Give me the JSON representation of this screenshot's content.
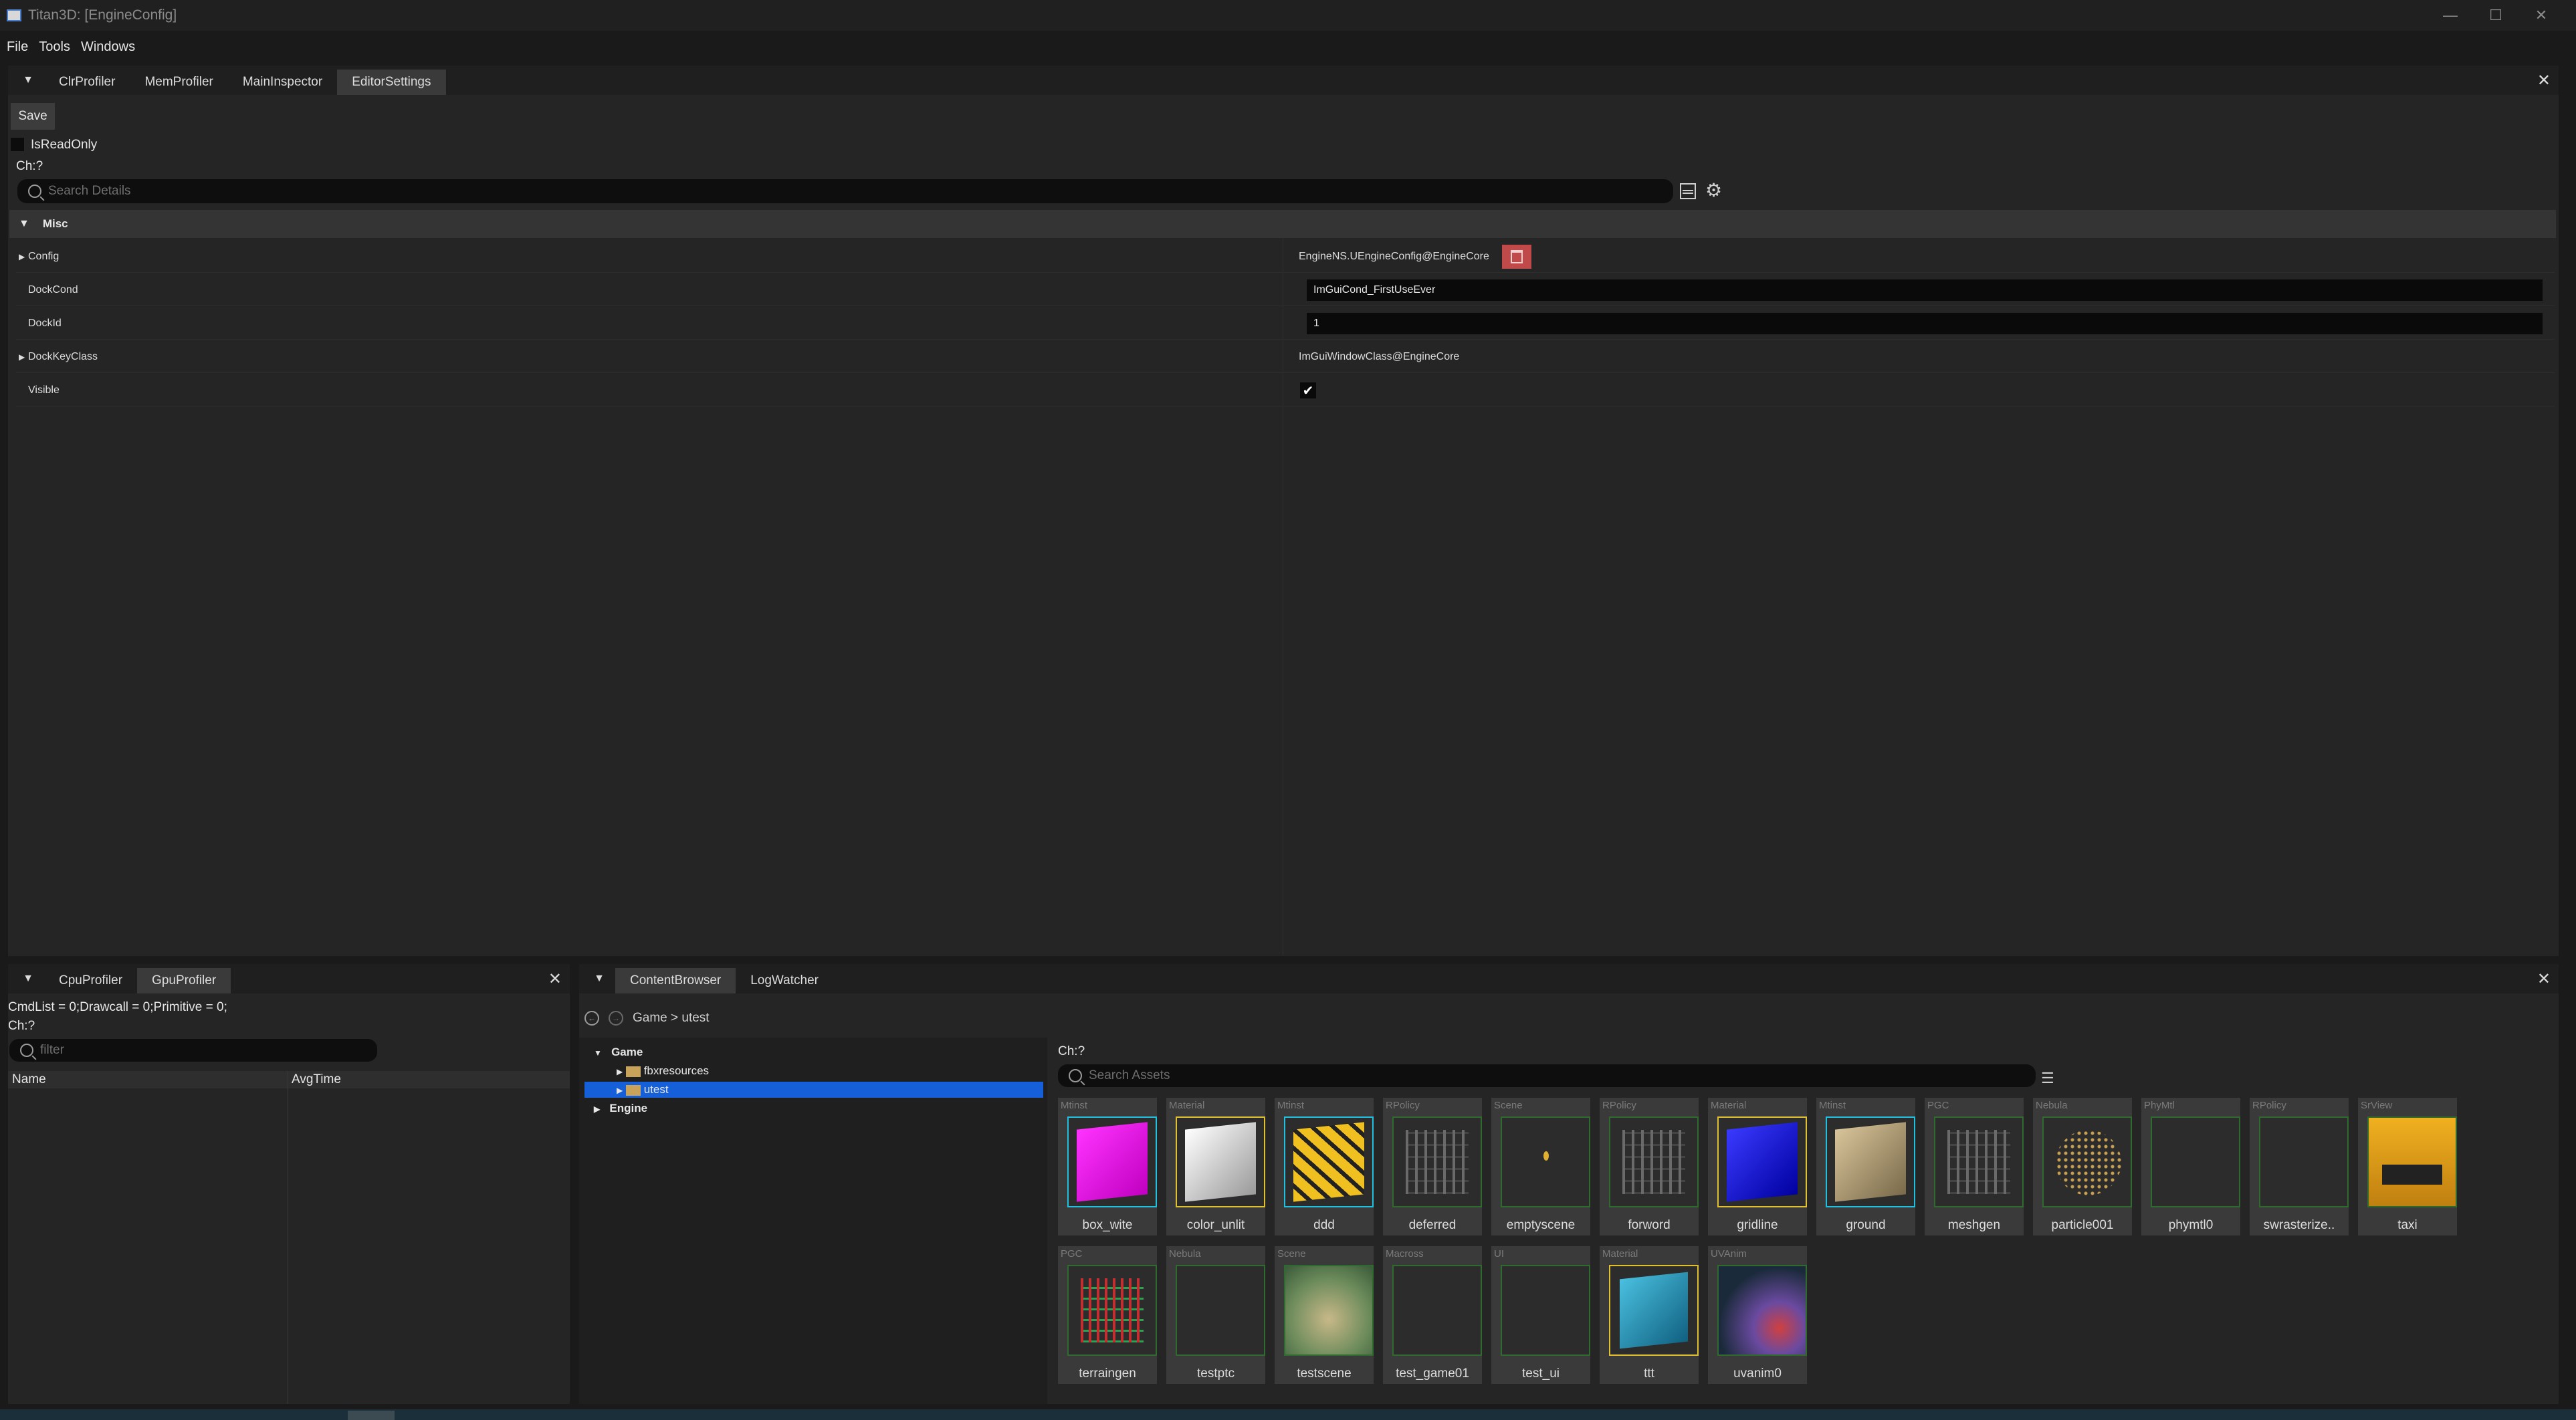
{
  "window": {
    "title": "Titan3D: [EngineConfig]"
  },
  "menu": [
    "File",
    "Tools",
    "Windows"
  ],
  "top_panel": {
    "tabs": [
      "ClrProfiler",
      "MemProfiler",
      "MainInspector",
      "EditorSettings"
    ],
    "active_tab": 3,
    "save_label": "Save",
    "readonly_label": "IsReadOnly",
    "ch_label": "Ch:?",
    "search_placeholder": "Search Details",
    "category": "Misc",
    "properties": [
      {
        "name": "Config",
        "value": "EngineNS.UEngineConfig@EngineCore",
        "expandable": true
      },
      {
        "name": "DockCond",
        "value": "ImGuiCond_FirstUseEver",
        "input": true
      },
      {
        "name": "DockId",
        "value": "1",
        "input": true
      },
      {
        "name": "DockKeyClass",
        "value": "ImGuiWindowClass@EngineCore",
        "expandable": true
      },
      {
        "name": "Visible",
        "checked": true
      }
    ]
  },
  "gpu_panel": {
    "tabs": [
      "CpuProfiler",
      "GpuProfiler"
    ],
    "active_tab": 1,
    "stats": "CmdList = 0;Drawcall = 0;Primitive = 0;",
    "ch_label": "Ch:?",
    "filter_placeholder": "filter",
    "columns": [
      "Name",
      "AvgTime"
    ]
  },
  "content_panel": {
    "tabs": [
      "ContentBrowser",
      "LogWatcher"
    ],
    "active_tab": 0,
    "breadcrumb": "Game > utest",
    "tree": {
      "game": "Game",
      "fbx": "fbxresources",
      "utest": "utest",
      "engine": "Engine"
    },
    "ch_label": "Ch:?",
    "search_placeholder": "Search Assets",
    "assets": [
      {
        "type": "Mtinst",
        "name": "box_wite",
        "art": "magenta-cube"
      },
      {
        "type": "Material",
        "name": "color_unlit",
        "art": "white-cube"
      },
      {
        "type": "Mtinst",
        "name": "ddd",
        "art": "yellow-cube"
      },
      {
        "type": "RPolicy",
        "name": "deferred",
        "art": "graph"
      },
      {
        "type": "Scene",
        "name": "emptyscene",
        "art": "dark-dot"
      },
      {
        "type": "RPolicy",
        "name": "forword",
        "art": "graph"
      },
      {
        "type": "Material",
        "name": "gridline",
        "art": "blue-cube"
      },
      {
        "type": "Mtinst",
        "name": "ground",
        "art": "sand-cube"
      },
      {
        "type": "PGC",
        "name": "meshgen",
        "art": "graph"
      },
      {
        "type": "Nebula",
        "name": "particle001",
        "art": "particles"
      },
      {
        "type": "PhyMtl",
        "name": "phymtl0",
        "art": "empty"
      },
      {
        "type": "RPolicy",
        "name": "swrasterize..",
        "art": "empty"
      },
      {
        "type": "SrView",
        "name": "taxi",
        "art": "taxi"
      },
      {
        "type": "PGC",
        "name": "terraingen",
        "art": "graph-color"
      },
      {
        "type": "Nebula",
        "name": "testptc",
        "art": "empty"
      },
      {
        "type": "Scene",
        "name": "testscene",
        "art": "terrain"
      },
      {
        "type": "Macross",
        "name": "test_game01",
        "art": "empty"
      },
      {
        "type": "UI",
        "name": "test_ui",
        "art": "empty"
      },
      {
        "type": "Material",
        "name": "ttt",
        "art": "teal-cube"
      },
      {
        "type": "UVAnim",
        "name": "uvanim0",
        "art": "swirl"
      }
    ]
  }
}
